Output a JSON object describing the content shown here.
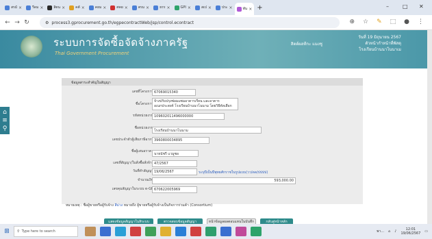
{
  "browser": {
    "tabs": [
      {
        "label": "สรมั",
        "color": "#4a7fd6"
      },
      {
        "label": "รีดม",
        "color": "#4a7fd6"
      },
      {
        "label": "สิตน",
        "color": "#2a2a2a"
      },
      {
        "label": "คตั",
        "color": "#e0a020"
      },
      {
        "label": "คยม",
        "color": "#4a7fd6"
      },
      {
        "label": "ศคย",
        "color": "#d03030"
      },
      {
        "label": "ตรม",
        "color": "#4a7fd6"
      },
      {
        "label": "ธรร",
        "color": "#4a7fd6"
      },
      {
        "label": "GPI",
        "color": "#2ea36b"
      },
      {
        "label": "สเป",
        "color": "#4a7fd6"
      },
      {
        "label": "ประ",
        "color": "#4a7fd6"
      },
      {
        "label": "พัน",
        "color": "#b05ad6"
      }
    ],
    "new_tab": "+",
    "url": "process3.gprocurement.go.th/egpecontractWeb/jsp/control.econtract",
    "window_controls": [
      "–",
      "□",
      "✕"
    ]
  },
  "header": {
    "title": "ระบบการจัดซื้อจัดจ้างภาครัฐ",
    "subtitle": "Thai Government Procurement",
    "date_line1": "วันที่ 19 มิถุนายน 2567",
    "date_line2": "ตัวหน้ากำหน้าที่พัสดุ",
    "date_line3": "โรงเรียนบ้านนาโนนาเม",
    "user": "สิตต์ผลทีกะ แมงชู"
  },
  "sidebar": {
    "icons": [
      "home-icon",
      "menu-icon",
      "search-icon"
    ]
  },
  "form": {
    "section_title": "ข้อมูลสาระสำคัญในสัญญา",
    "fields": [
      {
        "label": "เลขที่โครงการ",
        "value": "67069015340"
      },
      {
        "label": "ชื่อโครงการ",
        "value": "จ้างปรับปรุงซ่อมแซมอาคารเรียน และอาคารอเนกประสงค์ โรงเรียนบ้านนาโนนาม โดยวิธีคัดเลือก"
      },
      {
        "label": "รหัสหน่วยงาน",
        "value": "109602011496000000"
      },
      {
        "label": "ชื่อหน่วยงาน",
        "value": "โรงเรียนบ้านนาโนนาม"
      },
      {
        "label": "เลขประจำตัวผู้เสียภาษีอากร",
        "value": "3960800034895"
      },
      {
        "label": "ชื่อผู้เสนอราคา",
        "value": "นายนัชรี แวมูซอ"
      },
      {
        "label": "เลขที่สัญญา/ใบสั่งซื้อสั่งจ้าง",
        "value": "47/2567"
      },
      {
        "label": "วันที่ทำสัญญา",
        "value": "19/06/2567",
        "hint": "ระบุปีเป็นปีพุทธศักราชในรูปแบบ(วว/ดด/ปปปป)"
      },
      {
        "label": "จำนวนเงิน",
        "value": "593,000.00"
      },
      {
        "label": "เลขคุมสัญญาในระบบ e-GP",
        "value": "670622005969"
      }
    ],
    "note_prefix": "หมายเหตุ : ชื่อผู้ขายหรือผู้รับจ้าง",
    "note_blue": "สีม่วง",
    "note_suffix": "หมายถึง ผู้ขายหรือผู้รับจ้างเป็นกิจการร่วมค้า (Consortium)",
    "buttons": [
      {
        "label": "แสดงข้อมูลสัญญาในสิระบบ",
        "color": "#2e8b8b"
      },
      {
        "label": "ตรวจสอบข้อมูลสัญญา",
        "color": "#2e8b8b"
      },
      {
        "label": "หน้าข้อมูลผลตอบแทนในบันทึก",
        "color": "#e8e8e8"
      },
      {
        "label": "กลับสู่หน้าหลัก",
        "color": "#2e8b8b"
      }
    ]
  },
  "taskbar": {
    "search_placeholder": "Type here to search",
    "time": "12:01",
    "date": "19/06/2567",
    "tray_text": "พา..."
  }
}
